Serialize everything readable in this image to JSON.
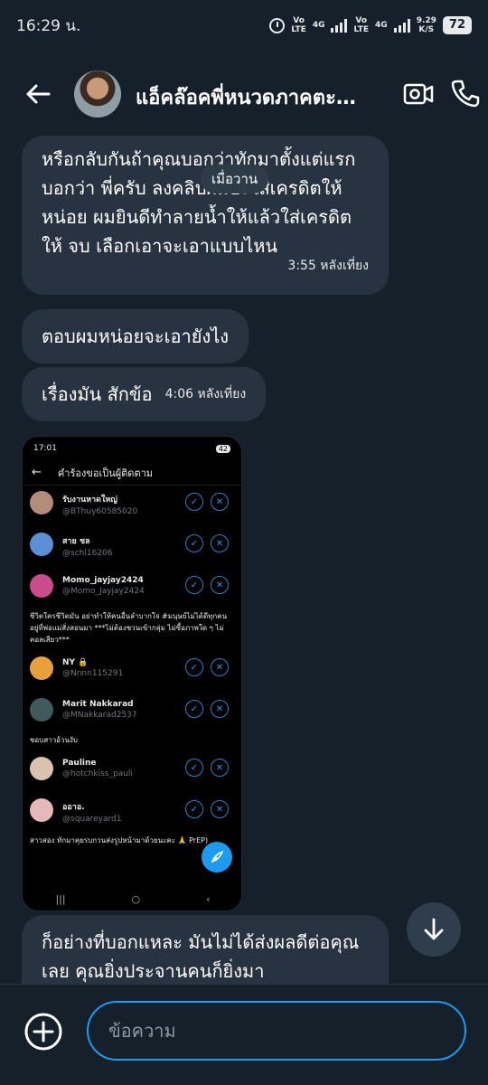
{
  "status": {
    "time": "16:29 น.",
    "volte1": "Vo\nLTE",
    "net1": "4G",
    "volte2": "Vo\nLTE",
    "net2": "4G",
    "speed": "9.29\nK/S",
    "battery": "72"
  },
  "header": {
    "title": "แอ็คล๊อคพี่หนวดภาคตะวันออก"
  },
  "date_pill": "เมื่อวาน",
  "messages": [
    {
      "text": "หรือกลับกันถ้าคุณบอกว่าทักมาตั้งแต่แรกบอกว่า พี่ครับ ลงคลิปผมบ่ะใส่เครดิตให้หน่อย ผมยินดีทำลายน้ำให้แล้วใส่เครดิตให้ จบ เลือกเอาจะเอาแบบไหน",
      "time": "3:55 หลังเที่ยง"
    },
    {
      "text": "ตอบผมหน่อยจะเอายังไง"
    },
    {
      "text": "เรื่องมัน สักข้อ",
      "time": "4:06 หลังเที่ยง"
    },
    {
      "text": "ก็อย่างที่บอกแหละ มันไม่ได้ส่งผลดีต่อคุณเลย คุณยิ่งประจานคนก็ยิ่งมา"
    }
  ],
  "shared_image": {
    "time": "17:01",
    "battery": "42",
    "title": "คำร้องขอเป็นผู้ติดตาม",
    "users": [
      {
        "name": "รับงานหาดใหญ่",
        "handle": "@BThuy60585020",
        "color": "#b48c7a"
      },
      {
        "name": "สาย ชล",
        "handle": "@schl16206",
        "color": "#5b8fd6"
      },
      {
        "name": "Momo_jayjay2424",
        "handle": "@Momo_Jayjay2424",
        "color": "#c94c8c",
        "bio": "ชีวิตใครชีวิตมัน อย่าทำให้คนอื่นลำบากใจ #มนุษย์ไม่ได้ดีทุกคน อยู่ที่พ่อแม่สั่งสอนมา ***ไม่ต้องชวนเข้ากลุ่ม ไม่ซื้อภาพใด ๆ ไม่คอลเสียว***"
      },
      {
        "name": "NY 🔒",
        "handle": "@Nnnn115291",
        "color": "#e8a13a"
      },
      {
        "name": "Marit Nakkarad",
        "handle": "@MNakkarad2537",
        "color": "#3e5a5a",
        "bio": "ชอบสาวอ้วนงับ"
      },
      {
        "name": "Pauline",
        "handle": "@hotchkiss_pauli",
        "color": "#d9c2b0"
      },
      {
        "name": "ออาอ.",
        "handle": "@squareyard1",
        "color": "#e6b8b8",
        "bio": "สาวสอง ทักมาคุยรบกวนส่งรูปหน้ามาด้วยนะคะ 🙏 PrEP)"
      }
    ]
  },
  "composer": {
    "placeholder": "ข้อความ"
  },
  "colors": {
    "background": "#15202b",
    "bubble": "#273340",
    "accent": "#1d9bf0"
  },
  "icons": [
    "back-arrow-icon",
    "video-call-icon",
    "phone-icon",
    "scroll-down-icon",
    "add-icon"
  ]
}
